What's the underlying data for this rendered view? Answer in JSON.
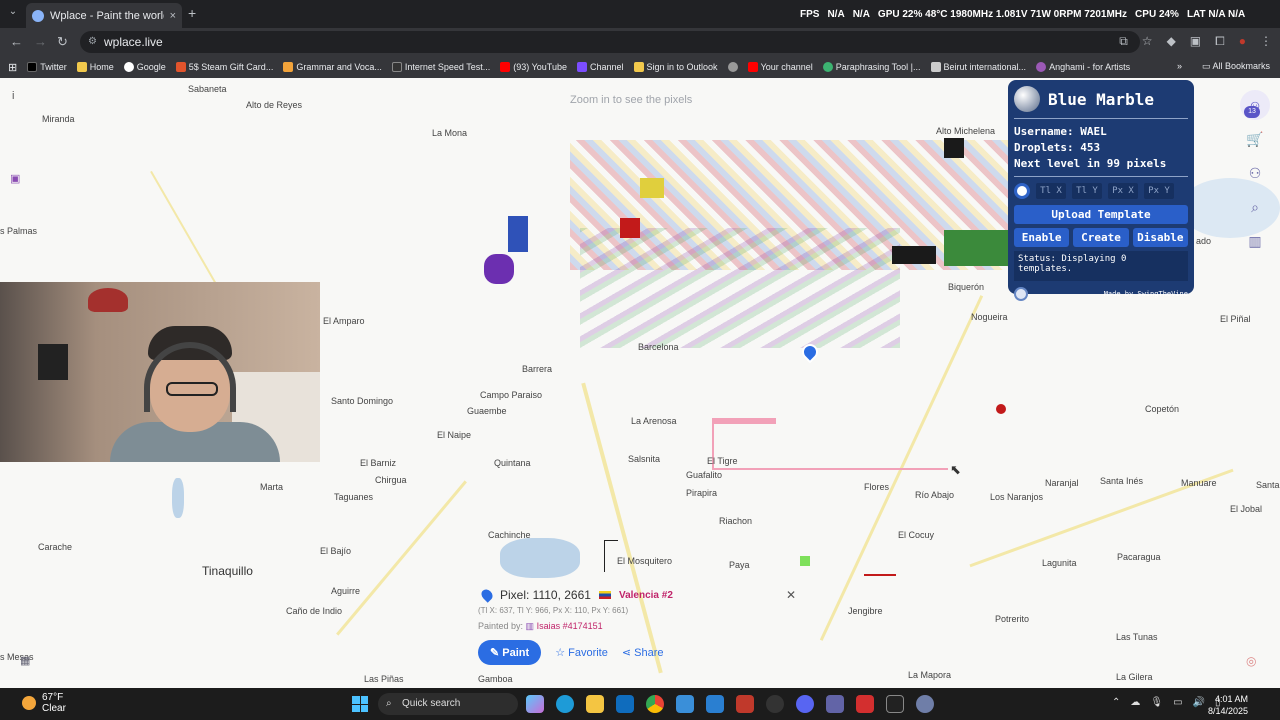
{
  "browser": {
    "tab_title": "Wplace - Paint the world",
    "url": "wplace.live",
    "new_tab": "+",
    "close": "×"
  },
  "osd": {
    "fps_label": "FPS",
    "fps_value": "N/A",
    "fps_value2": "N/A",
    "gpu": "GPU 22% 48°C 1980MHz 1.081V 71W 0RPM 7201MHz",
    "cpu": "CPU 24%",
    "lat": "LAT N/A N/A"
  },
  "bookmarks": [
    {
      "label": "Twitter",
      "color": "#000000"
    },
    {
      "label": "Home",
      "color": "#f2c94c"
    },
    {
      "label": "Google",
      "color": "#ffffff"
    },
    {
      "label": "5$ Steam Gift Card...",
      "color": "#e2542c"
    },
    {
      "label": "Grammar and Voca...",
      "color": "#f2a33a"
    },
    {
      "label": "Internet Speed Test...",
      "color": "#333333"
    },
    {
      "label": "(93) YouTube",
      "color": "#ff0000"
    },
    {
      "label": "Channel",
      "color": "#7c4dff"
    },
    {
      "label": "Sign in to Outlook",
      "color": "#f2c94c"
    },
    {
      "label": "",
      "color": "#999999"
    },
    {
      "label": "Your channel",
      "color": "#ff0000"
    },
    {
      "label": "Paraphrasing Tool |...",
      "color": "#3cb371"
    },
    {
      "label": "Beirut international...",
      "color": "#cccccc"
    },
    {
      "label": "Anghami - for Artists",
      "color": "#9b59b6"
    }
  ],
  "all_bookmarks": "All Bookmarks",
  "map": {
    "zoom_hint": "Zoom in to see the pixels",
    "towns": [
      {
        "name": "Sabaneta"
      },
      {
        "name": "Alto de Reyes"
      },
      {
        "name": "Miranda"
      },
      {
        "name": "La Mona"
      },
      {
        "name": "s Palmas"
      },
      {
        "name": "El Amparo"
      },
      {
        "name": "Santo Domingo"
      },
      {
        "name": "El Naipe"
      },
      {
        "name": "El Barniz"
      },
      {
        "name": "Chirgua"
      },
      {
        "name": "Marta"
      },
      {
        "name": "Taguanes"
      },
      {
        "name": "Carache"
      },
      {
        "name": "El Bajío"
      },
      {
        "name": "Aguirre"
      },
      {
        "name": "Caño de Indio"
      },
      {
        "name": "s Mesas"
      },
      {
        "name": "Las Piñas"
      },
      {
        "name": "Barrera"
      },
      {
        "name": "Campo Paraiso"
      },
      {
        "name": "Guaembe"
      },
      {
        "name": "Quintana"
      },
      {
        "name": "La Arenosa"
      },
      {
        "name": "Salsnita"
      },
      {
        "name": "El Tigre"
      },
      {
        "name": "Guafalito"
      },
      {
        "name": "Pirapira"
      },
      {
        "name": "Cachinche"
      },
      {
        "name": "Riachon"
      },
      {
        "name": "El Mosquitero"
      },
      {
        "name": "Paya"
      },
      {
        "name": "Flores"
      },
      {
        "name": "Río Abajo"
      },
      {
        "name": "Los Naranjos"
      },
      {
        "name": "El Cocuy"
      },
      {
        "name": "Jengibre"
      },
      {
        "name": "Naranjal"
      },
      {
        "name": "Santa Inés"
      },
      {
        "name": "Manuare"
      },
      {
        "name": "El Jobal"
      },
      {
        "name": "Pacaragua"
      },
      {
        "name": "Lagunita"
      },
      {
        "name": "Potrerito"
      },
      {
        "name": "Las Tunas"
      },
      {
        "name": "La Gilera"
      },
      {
        "name": "La Mapora"
      },
      {
        "name": "Copetón"
      },
      {
        "name": "El Piñal"
      },
      {
        "name": "Nogueira"
      },
      {
        "name": "Biquerón"
      },
      {
        "name": "Alto Michelena"
      },
      {
        "name": "ado"
      },
      {
        "name": "Barcelona"
      },
      {
        "name": "Tinaquillo"
      },
      {
        "name": "Santa"
      },
      {
        "name": "Gamboa"
      }
    ]
  },
  "blue_marble": {
    "title": "Blue Marble",
    "username": "Username: WAEL",
    "droplets": "Droplets: 453",
    "next_level": "Next level in 99 pixels",
    "coord_labels": [
      "Tl X",
      "Tl Y",
      "Px X",
      "Px Y"
    ],
    "upload": "Upload Template",
    "enable": "Enable",
    "create": "Create",
    "disable": "Disable",
    "status": "Status: Displaying 0 templates.",
    "credit": "Made by SwingTheVine"
  },
  "tools": {
    "level": "13"
  },
  "pixel_card": {
    "pixel": "Pixel: 1110, 2661",
    "region": "Valencia #2",
    "coords": "(Tl X: 637, Tl Y: 966, Px X: 110, Px Y: 661)",
    "painted_by_label": "Painted by:",
    "painted_by_user": "Isaias #4174151",
    "paint": "Paint",
    "favorite": "Favorite",
    "share": "Share"
  },
  "taskbar": {
    "temp": "67°F",
    "weather": "Clear",
    "search": "Quick search",
    "time": "4:01 AM",
    "date": "8/14/2025"
  }
}
